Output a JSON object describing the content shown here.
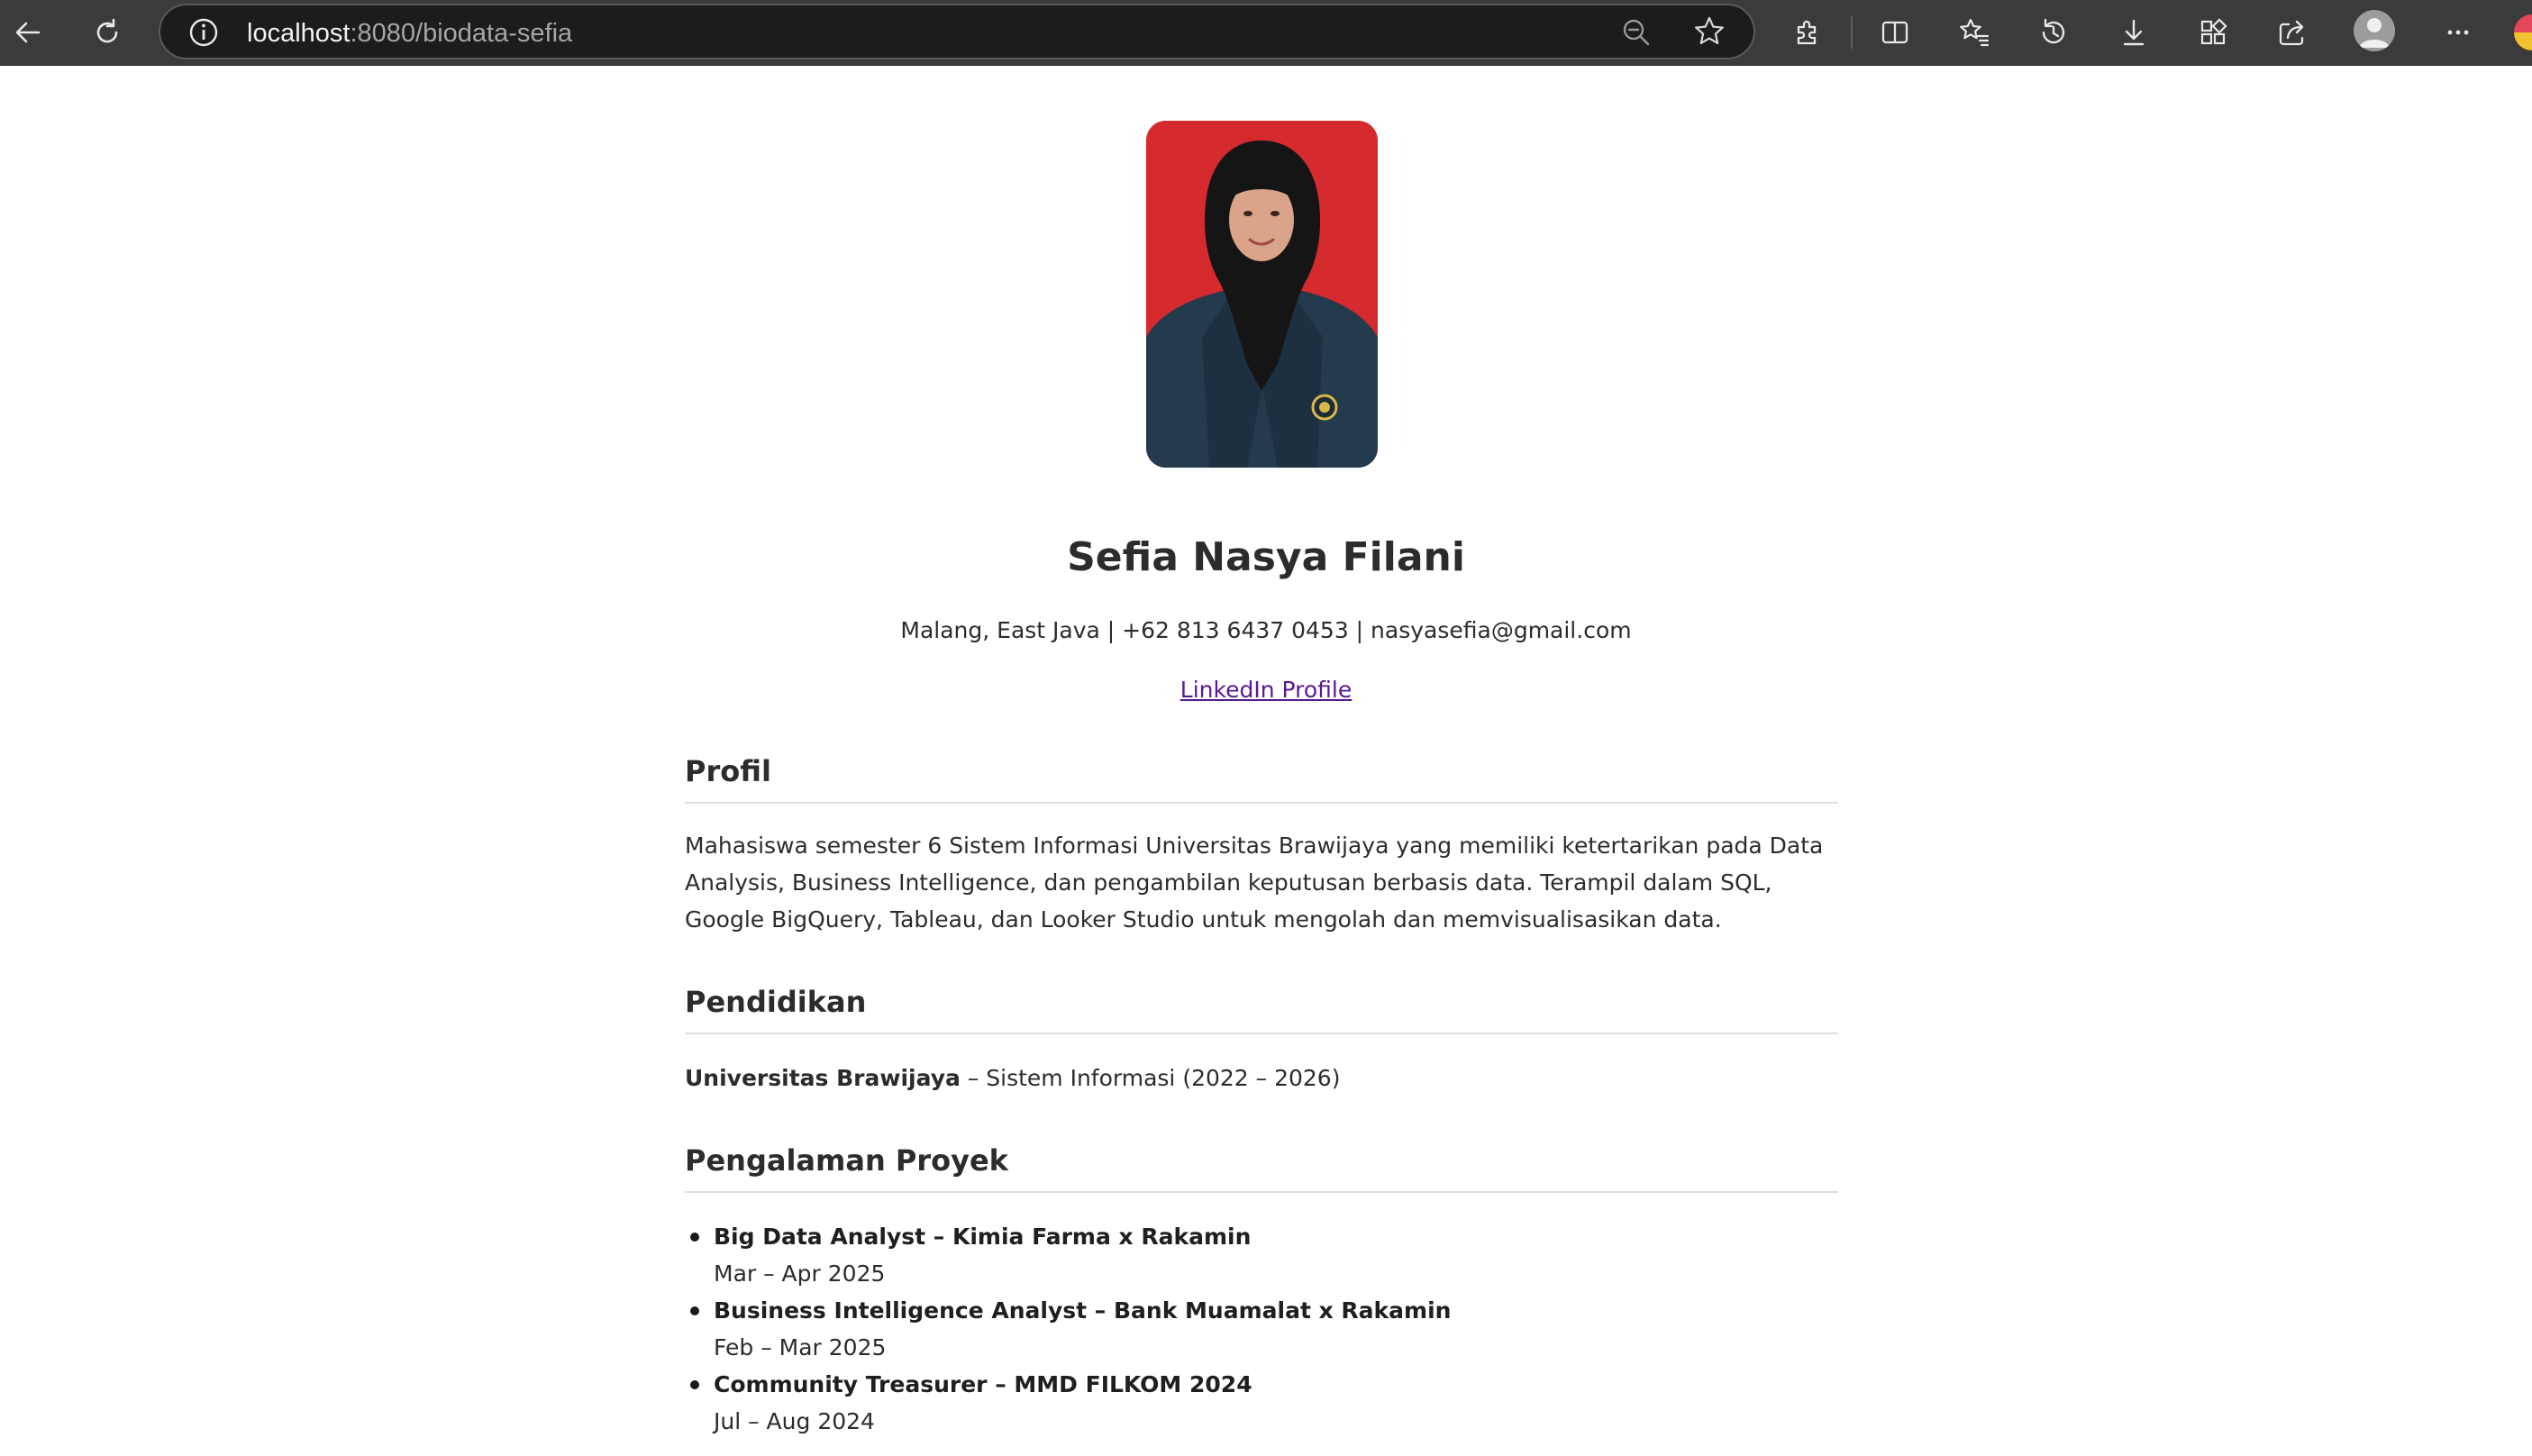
{
  "browser": {
    "url_host": "localhost",
    "url_path": ":8080/biodata-sefia"
  },
  "profile": {
    "name": "Sefia Nasya Filani",
    "contact": "Malang, East Java | +62 813 6437 0453 | nasyasefia@gmail.com",
    "linkedin_label": "LinkedIn Profile"
  },
  "sections": {
    "profil": {
      "heading": "Profil",
      "text": "Mahasiswa semester 6 Sistem Informasi Universitas Brawijaya yang memiliki ketertarikan pada Data Analysis, Business Intelligence, dan pengambilan keputusan berbasis data. Terampil dalam SQL, Google BigQuery, Tableau, dan Looker Studio untuk mengolah dan memvisualisasikan data."
    },
    "pendidikan": {
      "heading": "Pendidikan",
      "institution": "Universitas Brawijaya",
      "detail": " – Sistem Informasi (2022 – 2026)"
    },
    "proyek": {
      "heading": "Pengalaman Proyek",
      "items": [
        {
          "title": "Big Data Analyst – Kimia Farma x Rakamin",
          "date": "Mar – Apr 2025"
        },
        {
          "title": "Business Intelligence Analyst – Bank Muamalat x Rakamin",
          "date": "Feb – Mar 2025"
        },
        {
          "title": "Community Treasurer – MMD FILKOM 2024",
          "date": "Jul – Aug 2024"
        }
      ]
    }
  },
  "colors": {
    "chrome": "#3b3b3b",
    "addressbar": "#1c1c1c",
    "photo_background": "#d52a2e",
    "link": "#5a1a8f",
    "text": "#2c2c2c"
  }
}
